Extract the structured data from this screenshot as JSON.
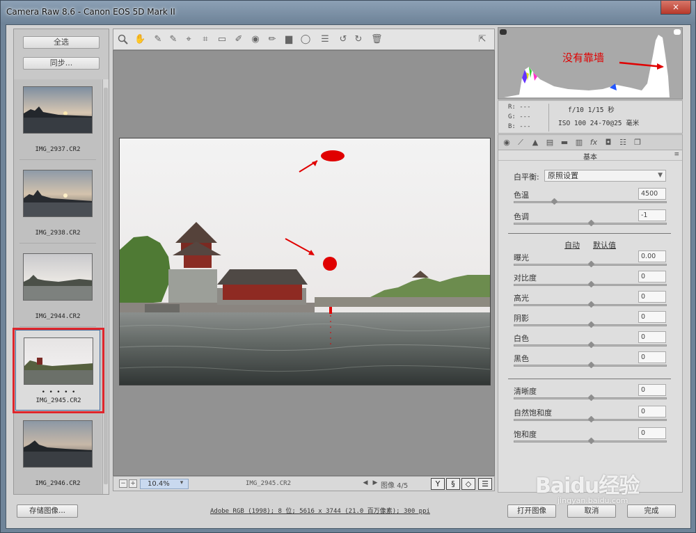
{
  "window": {
    "title": "Camera Raw 8.6 -  Canon EOS 5D Mark II",
    "close_label": "×"
  },
  "filmstrip": {
    "select_all": "全选",
    "sync": "同步...",
    "items": [
      {
        "name": "IMG_2937.CR2"
      },
      {
        "name": "IMG_2938.CR2"
      },
      {
        "name": "IMG_2944.CR2"
      },
      {
        "name": "IMG_2945.CR2",
        "rating": "• • • • •",
        "selected": true
      },
      {
        "name": "IMG_2946.CR2"
      }
    ]
  },
  "toolbar": {
    "tools": [
      "zoom-icon",
      "hand-icon",
      "white-balance-icon",
      "color-sampler-icon",
      "target-adjust-icon",
      "crop-icon",
      "straighten-icon",
      "spot-removal-icon",
      "red-eye-icon",
      "adjustment-brush-icon",
      "graduated-filter-icon",
      "radial-filter-icon",
      "preferences-icon",
      "rotate-ccw-icon",
      "rotate-cw-icon",
      "trash-icon"
    ],
    "fullscreen": "fullscreen-icon"
  },
  "status": {
    "zoom": "10.4%",
    "filename": "IMG_2945.CR2",
    "image_count": "图像 4/5",
    "view_buttons": [
      "Y",
      "§",
      "◇",
      "☰"
    ]
  },
  "histogram": {
    "annotation": "没有靠墙",
    "colors": {
      "annotation": "#e0252b"
    }
  },
  "readout": {
    "r": "R:  ---",
    "g": "G:  ---",
    "b": "B:  ---",
    "exposure": "f/10   1/15 秒",
    "iso_lens": "ISO 100   24-70@25 毫米"
  },
  "panel": {
    "title": "基本",
    "white_balance_label": "白平衡:",
    "white_balance_value": "原照设置",
    "sliders_wb": [
      {
        "label": "色温",
        "value": "4500",
        "pos": 0.25
      },
      {
        "label": "色调",
        "value": "-1",
        "pos": 0.5
      }
    ],
    "auto": "自动",
    "default": "默认值",
    "sliders_tone": [
      {
        "label": "曝光",
        "value": "0.00",
        "pos": 0.5
      },
      {
        "label": "对比度",
        "value": "0",
        "pos": 0.5
      },
      {
        "label": "高光",
        "value": "0",
        "pos": 0.5
      },
      {
        "label": "阴影",
        "value": "0",
        "pos": 0.5
      },
      {
        "label": "白色",
        "value": "0",
        "pos": 0.5
      },
      {
        "label": "黑色",
        "value": "0",
        "pos": 0.5
      }
    ],
    "sliders_presence": [
      {
        "label": "清晰度",
        "value": "0",
        "pos": 0.5
      },
      {
        "label": "自然饱和度",
        "value": "0",
        "pos": 0.5
      },
      {
        "label": "饱和度",
        "value": "0",
        "pos": 0.5
      }
    ]
  },
  "bottom": {
    "save": "存储图像...",
    "workflow": "Adobe RGB (1998); 8 位; 5616 x 3744 (21.0 百万像素); 300 ppi",
    "open": "打开图像",
    "cancel": "取消",
    "done": "完成"
  },
  "watermark": {
    "brand": "Baidu经验",
    "url": "jingyan.baidu.com"
  }
}
